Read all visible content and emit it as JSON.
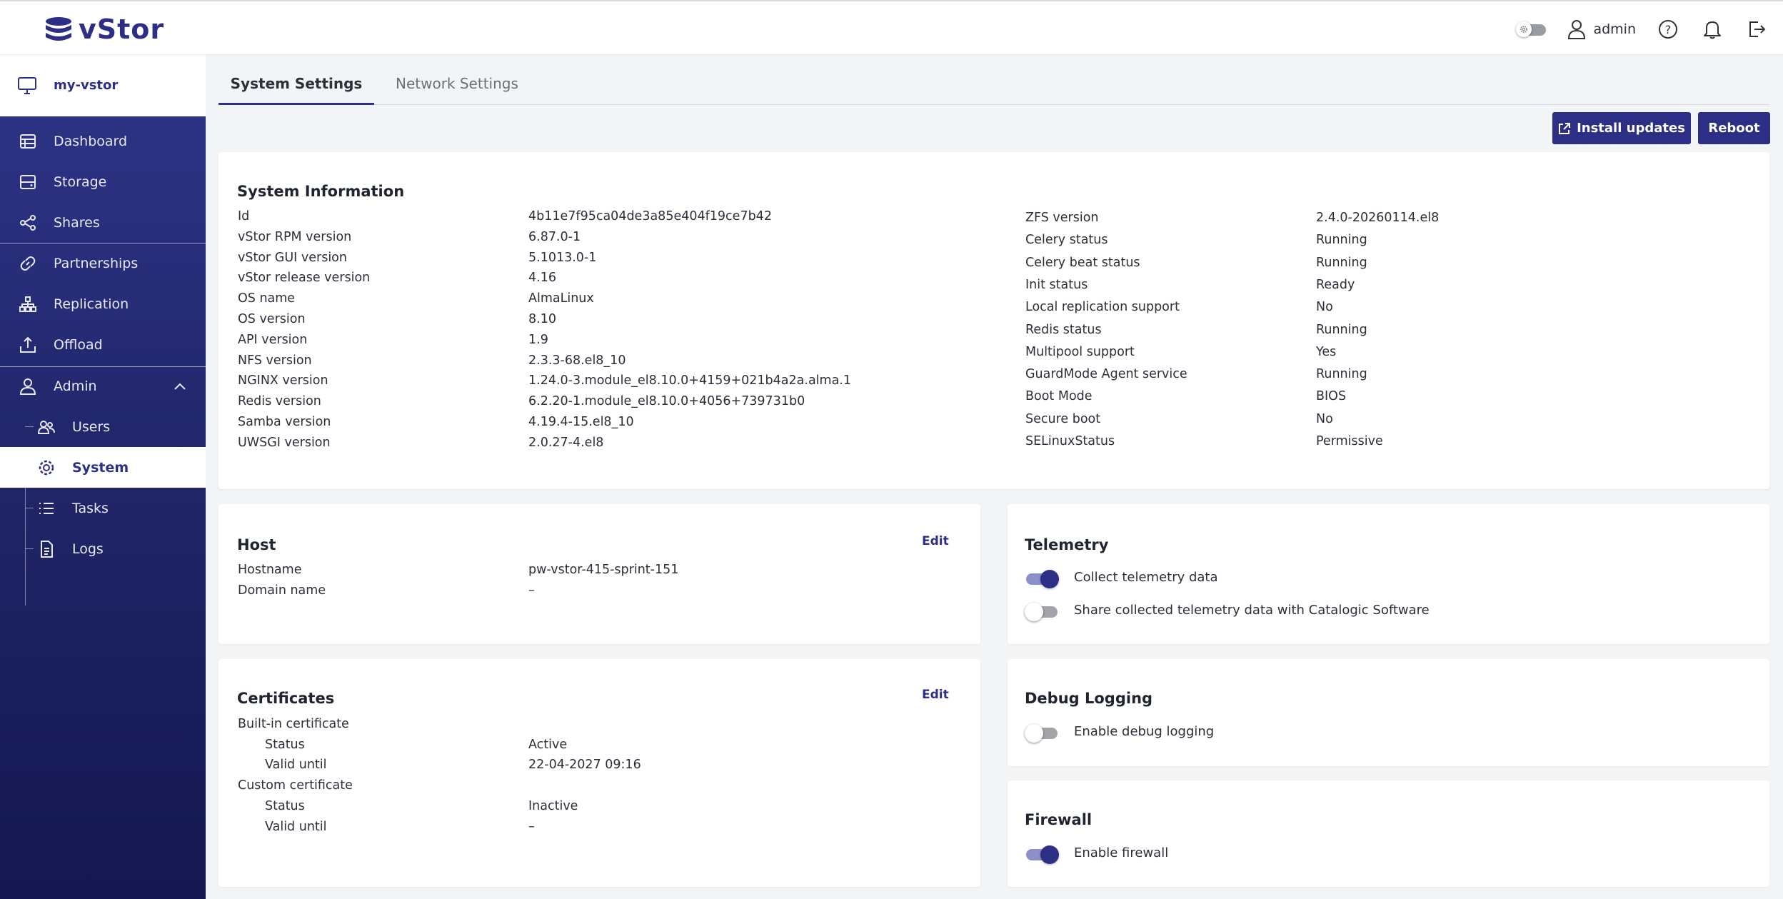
{
  "app": {
    "logo_text": "vStor",
    "brand_color": "#2d2f86"
  },
  "header": {
    "username": "admin"
  },
  "sidebar": {
    "device_name": "my-vstor",
    "items": [
      {
        "label": "Dashboard",
        "icon": "dashboard-icon"
      },
      {
        "label": "Storage",
        "icon": "storage-icon"
      },
      {
        "label": "Shares",
        "icon": "share-icon"
      },
      {
        "label": "Partnerships",
        "icon": "link-icon"
      },
      {
        "label": "Replication",
        "icon": "replication-icon"
      },
      {
        "label": "Offload",
        "icon": "upload-icon"
      },
      {
        "label": "Admin",
        "icon": "user-icon"
      }
    ],
    "admin_sub": [
      {
        "label": "Users",
        "icon": "users-icon"
      },
      {
        "label": "System",
        "icon": "gear-icon",
        "active": true
      },
      {
        "label": "Tasks",
        "icon": "list-icon"
      },
      {
        "label": "Logs",
        "icon": "document-icon"
      }
    ]
  },
  "tabs": [
    {
      "label": "System Settings",
      "active": true
    },
    {
      "label": "Network Settings",
      "active": false
    }
  ],
  "actions": {
    "install_updates": "Install updates",
    "reboot": "Reboot"
  },
  "system_info": {
    "title": "System Information",
    "left": [
      {
        "key": "Id",
        "value": "4b11e7f95ca04de3a85e404f19ce7b42"
      },
      {
        "key": "vStor RPM version",
        "value": "6.87.0-1"
      },
      {
        "key": "vStor GUI version",
        "value": "5.1013.0-1"
      },
      {
        "key": "vStor release version",
        "value": "4.16"
      },
      {
        "key": "OS name",
        "value": "AlmaLinux"
      },
      {
        "key": "OS version",
        "value": "8.10"
      },
      {
        "key": "API version",
        "value": "1.9"
      },
      {
        "key": "NFS version",
        "value": "2.3.3-68.el8_10"
      },
      {
        "key": "NGINX version",
        "value": "1.24.0-3.module_el8.10.0+4159+021b4a2a.alma.1"
      },
      {
        "key": "Redis version",
        "value": "6.2.20-1.module_el8.10.0+4056+739731b0"
      },
      {
        "key": "Samba version",
        "value": "4.19.4-15.el8_10"
      },
      {
        "key": "UWSGI version",
        "value": "2.0.27-4.el8"
      }
    ],
    "right": [
      {
        "key": "ZFS version",
        "value": "2.4.0-20260114.el8"
      },
      {
        "key": "Celery status",
        "value": "Running"
      },
      {
        "key": "Celery beat status",
        "value": "Running"
      },
      {
        "key": "Init status",
        "value": "Ready"
      },
      {
        "key": "Local replication support",
        "value": "No"
      },
      {
        "key": "Redis status",
        "value": "Running"
      },
      {
        "key": "Multipool support",
        "value": "Yes"
      },
      {
        "key": "GuardMode Agent service",
        "value": "Running"
      },
      {
        "key": "Boot Mode",
        "value": "BIOS"
      },
      {
        "key": "Secure boot",
        "value": "No"
      },
      {
        "key": "SELinuxStatus",
        "value": "Permissive"
      }
    ]
  },
  "host": {
    "title": "Host",
    "edit": "Edit",
    "rows": [
      {
        "key": "Hostname",
        "value": "pw-vstor-415-sprint-151"
      },
      {
        "key": "Domain name",
        "value": "–"
      }
    ]
  },
  "certificates": {
    "title": "Certificates",
    "edit": "Edit",
    "builtin": {
      "label": "Built-in certificate",
      "status_key": "Status",
      "status": "Active",
      "valid_key": "Valid until",
      "valid": "22-04-2027 09:16"
    },
    "custom": {
      "label": "Custom certificate",
      "status_key": "Status",
      "status": "Inactive",
      "valid_key": "Valid until",
      "valid": "–"
    }
  },
  "telemetry": {
    "title": "Telemetry",
    "collect_label": "Collect telemetry data",
    "collect_on": true,
    "share_label": "Share collected telemetry data with Catalogic Software",
    "share_on": false
  },
  "debug": {
    "title": "Debug Logging",
    "label": "Enable debug logging",
    "on": false
  },
  "firewall": {
    "title": "Firewall",
    "label": "Enable firewall",
    "on": true
  }
}
